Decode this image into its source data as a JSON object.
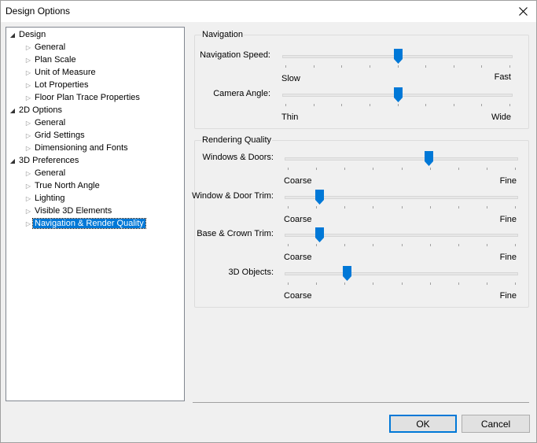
{
  "window": {
    "title": "Design Options"
  },
  "tree": [
    {
      "label": "Design",
      "level": 0,
      "state": "open"
    },
    {
      "label": "General",
      "level": 1,
      "state": "closed"
    },
    {
      "label": "Plan Scale",
      "level": 1,
      "state": "closed"
    },
    {
      "label": "Unit of Measure",
      "level": 1,
      "state": "closed"
    },
    {
      "label": "Lot Properties",
      "level": 1,
      "state": "closed"
    },
    {
      "label": "Floor Plan Trace Properties",
      "level": 1,
      "state": "closed"
    },
    {
      "label": "2D Options",
      "level": 0,
      "state": "open"
    },
    {
      "label": "General",
      "level": 1,
      "state": "closed"
    },
    {
      "label": "Grid Settings",
      "level": 1,
      "state": "closed"
    },
    {
      "label": "Dimensioning and Fonts",
      "level": 1,
      "state": "closed"
    },
    {
      "label": "3D Preferences",
      "level": 0,
      "state": "open"
    },
    {
      "label": "General",
      "level": 1,
      "state": "closed"
    },
    {
      "label": "True North Angle",
      "level": 1,
      "state": "closed"
    },
    {
      "label": "Lighting",
      "level": 1,
      "state": "closed"
    },
    {
      "label": "Visible 3D Elements",
      "level": 1,
      "state": "closed"
    },
    {
      "label": "Navigation & Render Quality",
      "level": 1,
      "state": "closed",
      "selected": true
    }
  ],
  "navigation": {
    "title": "Navigation",
    "sliders": [
      {
        "label": "Navigation Speed:",
        "min_label": "Slow",
        "max_label": "Fast",
        "value": 0.5
      },
      {
        "label": "Camera Angle:",
        "min_label": "Thin",
        "max_label": "Wide",
        "value": 0.5
      }
    ]
  },
  "rendering": {
    "title": "Rendering Quality",
    "sliders": [
      {
        "label": "Windows & Doors:",
        "min_label": "Coarse",
        "max_label": "Fine",
        "value": 0.62
      },
      {
        "label": "Window & Door Trim:",
        "min_label": "Coarse",
        "max_label": "Fine",
        "value": 0.14
      },
      {
        "label": "Base & Crown Trim:",
        "min_label": "Coarse",
        "max_label": "Fine",
        "value": 0.14
      },
      {
        "label": "3D Objects:",
        "min_label": "Coarse",
        "max_label": "Fine",
        "value": 0.26
      }
    ]
  },
  "buttons": {
    "ok": "OK",
    "cancel": "Cancel"
  },
  "colors": {
    "accent": "#0078d7",
    "thumb": "#0078d7"
  }
}
